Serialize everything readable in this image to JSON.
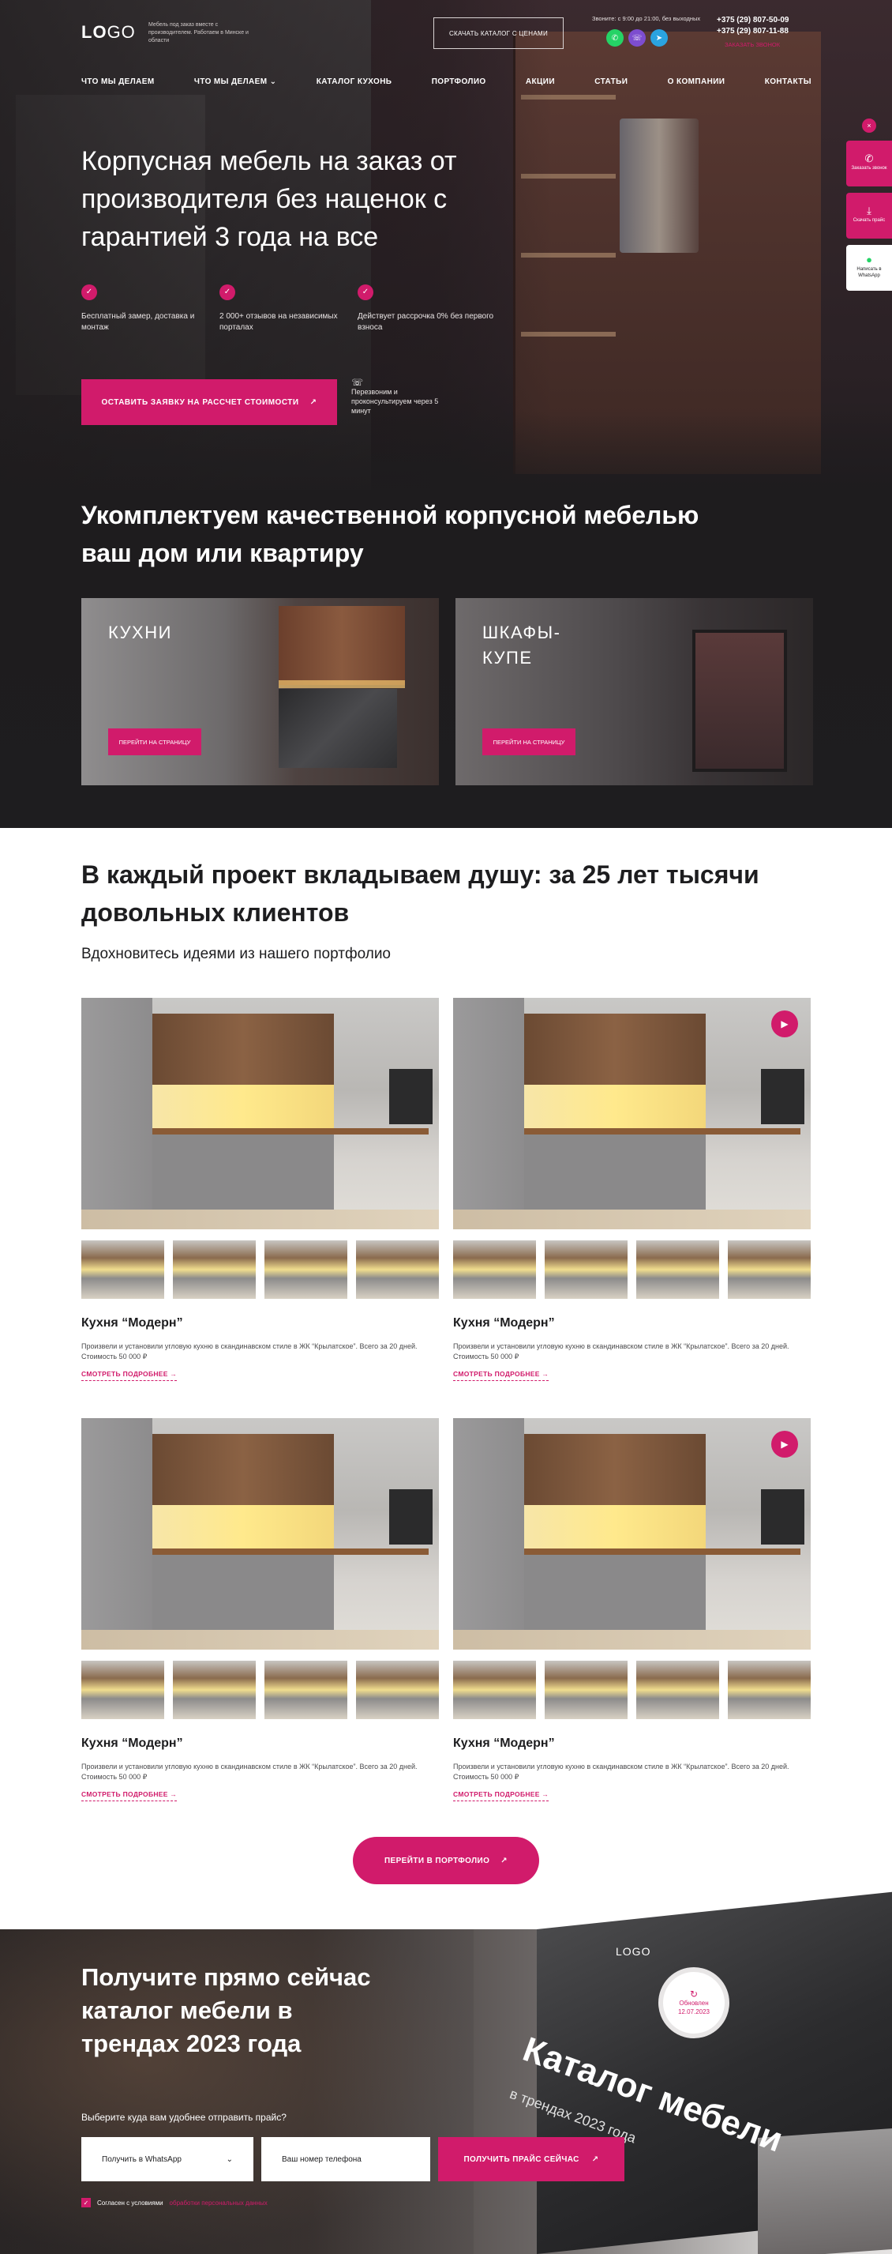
{
  "header": {
    "logo_bold": "LO",
    "logo_light": "GO",
    "tagline": "Мебель под заказ вместе с производителем. Работаем в Минске и области",
    "catalog_button": "Скачать каталог с ценами",
    "hours": "Звоните: с 9:00 до 21:00, без выходных",
    "phone1": "+375 (29) 807-50-09",
    "phone2": "+375 (29) 807-11-88",
    "callback": "Заказать звонок"
  },
  "nav": [
    "Что мы делаем",
    "Что мы делаем ⌄",
    "Каталог кухонь",
    "Портфолио",
    "Акции",
    "Статьи",
    "О компании",
    "Контакты"
  ],
  "side_rail": {
    "close": "×",
    "call": "Заказать звонок",
    "price": "Скачать прайс",
    "whatsapp": "Написать в WhatsApp"
  },
  "hero": {
    "title": "Корпусная мебель на заказ от производителя без наценок с гарантией 3 года на все",
    "bullets": [
      "Бесплатный замер, доставка и монтаж",
      "2 000+ отзывов на независимых порталах",
      "Действует рассрочка 0% без первого взноса"
    ],
    "cta": "Оставить заявку на рассчет стоимости",
    "cta_note": "Перезвоним и проконсультируем через 5 минут"
  },
  "categories": {
    "title": "Укомплектуем качественной корпусной мебелью ваш дом или квартиру",
    "items": [
      {
        "label": "КУХНИ",
        "button": "Перейти на страницу"
      },
      {
        "label": "ШКАФЫ-КУПЕ",
        "button": "Перейти на страницу"
      }
    ]
  },
  "portfolio": {
    "title": "В каждый проект вкладываем душу: за 25 лет  тысячи довольных клиентов",
    "subtitle": "Вдохновитесь идеями из нашего портфолио",
    "projects": [
      {
        "name": "Кухня “Модерн”",
        "desc": "Произвели и установили угловую кухню в скандинавском стиле в ЖК “Крылатское”. Всего за 20 дней. Стоимость 50 000 ₽",
        "more": "Смотреть подробнее →",
        "video": false
      },
      {
        "name": "Кухня “Модерн”",
        "desc": "Произвели и установили угловую кухню в скандинавском стиле в ЖК “Крылатское”. Всего за 20 дней. Стоимость 50 000 ₽",
        "more": "Смотреть подробнее →",
        "video": true
      },
      {
        "name": "Кухня “Модерн”",
        "desc": "Произвели и установили угловую кухню в скандинавском стиле в ЖК “Крылатское”. Всего за 20 дней. Стоимость 50 000 ₽",
        "more": "Смотреть подробнее →",
        "video": false
      },
      {
        "name": "Кухня “Модерн”",
        "desc": "Произвели и установили угловую кухню в скандинавском стиле в ЖК “Крылатское”. Всего за 20 дней. Стоимость 50 000 ₽",
        "more": "Смотреть подробнее →",
        "video": true
      }
    ],
    "button": "Перейти в портфолио"
  },
  "catalog_section": {
    "title": "Получите прямо сейчас каталог мебели в трендах 2023 года",
    "question": "Выберите куда вам удобнее отправить прайс?",
    "select_value": "Получить в WhatsApp",
    "phone_placeholder": "Ваш номер телефона",
    "submit": "Получить прайс сейчас",
    "agree_text": "Согласен с условиями",
    "agree_link": "обработки персональных данных",
    "magazine": {
      "logo": "LOGO",
      "title": "Каталог мебели",
      "subtitle": "в трендах 2023 года",
      "badge_line1": "Обновлен",
      "badge_line2": "12.07.2023"
    }
  },
  "colors": {
    "accent": "#d11b6b",
    "whatsapp": "#25d366",
    "viber": "#7d4dcf",
    "telegram": "#2aa3e0"
  }
}
